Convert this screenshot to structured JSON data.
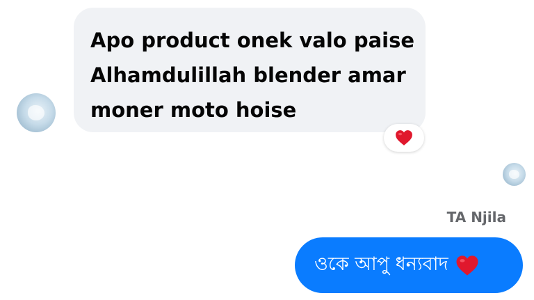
{
  "incoming_message": {
    "lines": [
      "Apo product onek valo paise",
      "Alhamdulillah blender amar",
      "moner moto hoise"
    ],
    "reaction_icon": "red-heart-icon"
  },
  "sender_name": "TA Njila",
  "outgoing_message": {
    "text": "ওকে আপু ধন্যবাদ",
    "emoji_icon": "red-heart-icon"
  },
  "colors": {
    "incoming_bubble": "#f0f2f5",
    "outgoing_bubble": "#0a7cff",
    "heart": "#e0182d",
    "sender_name": "#65676b"
  }
}
